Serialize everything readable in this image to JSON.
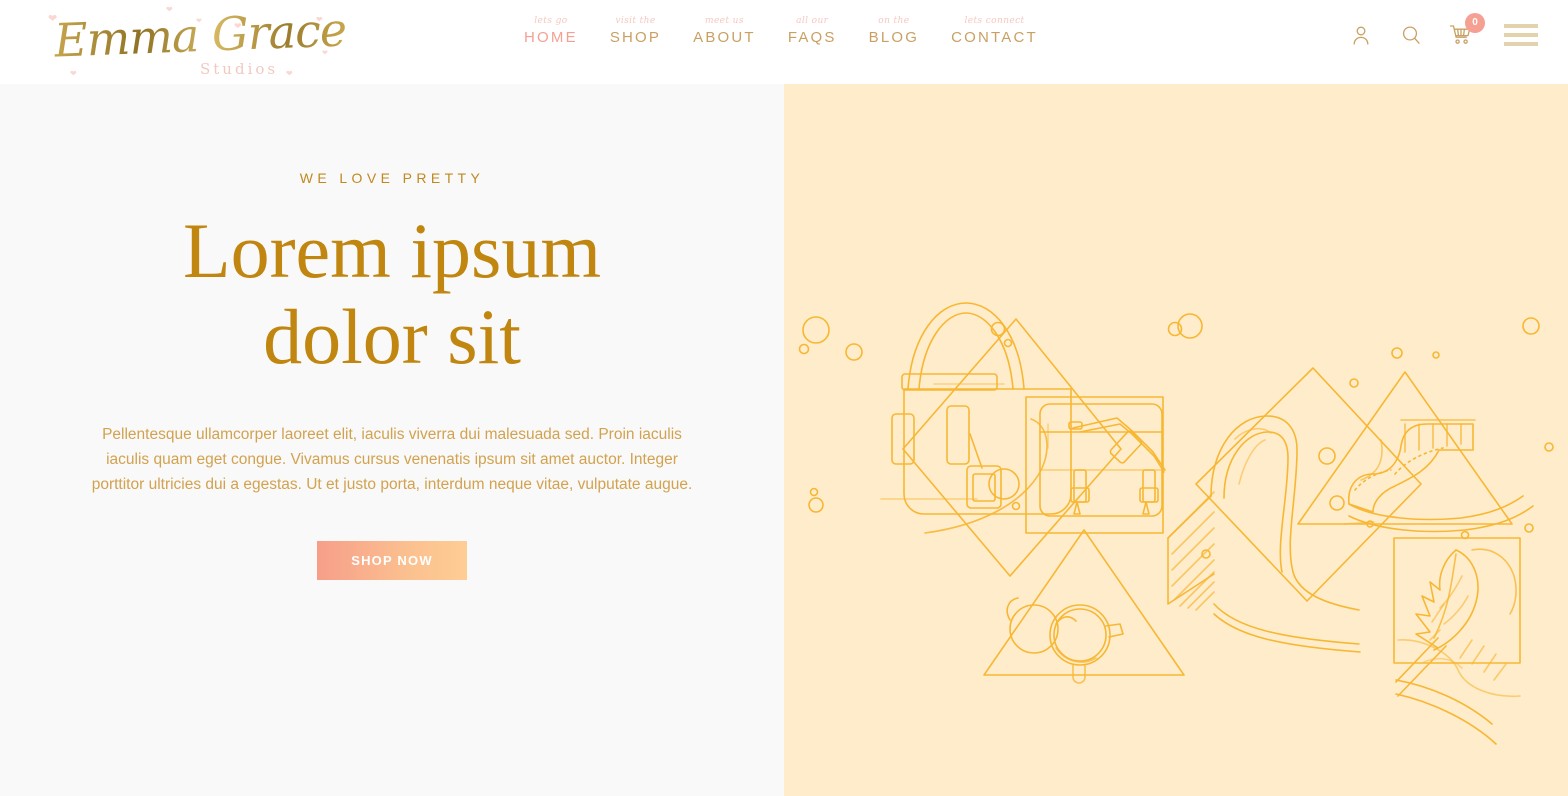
{
  "brand": {
    "name_script": "Emma Grace",
    "name_sub": "Studios",
    "gold": "#b59243",
    "pink": "#f1c9c1"
  },
  "nav": {
    "items": [
      {
        "pre": "lets go",
        "label": "HOME",
        "active": true
      },
      {
        "pre": "visit the",
        "label": "SHOP",
        "active": false
      },
      {
        "pre": "meet us",
        "label": "ABOUT",
        "active": false
      },
      {
        "pre": "all our",
        "label": "FAQS",
        "active": false
      },
      {
        "pre": "on the",
        "label": "BLOG",
        "active": false
      },
      {
        "pre": "lets connect",
        "label": "CONTACT",
        "active": false
      }
    ],
    "active_color": "#f4a193",
    "idle_color": "#c9a063",
    "pre_color": "#f6c8c1"
  },
  "header_icons": {
    "account": "account-icon",
    "search": "search-icon",
    "cart": "cart-icon",
    "cart_count": "0",
    "cart_badge_color": "#f6a093",
    "menu": "hamburger-menu-icon",
    "icon_color": "#c9a063"
  },
  "hero": {
    "eyebrow": "WE LOVE PRETTY",
    "headline": "Lorem ipsum dolor sit",
    "paragraph": "Pellentesque ullamcorper laoreet elit, iaculis viverra dui malesuada sed. Proin iaculis iaculis quam eget congue. Vivamus cursus venenatis ipsum sit amet auctor. Integer porttitor ultricies dui a egestas. Ut et justo porta, interdum neque vitae, vulputate augue.",
    "cta_label": "SHOP NOW",
    "left_bg": "#f9f9fa",
    "right_bg": "#ffeccb",
    "headline_color": "#c0860f",
    "eyebrow_color": "#c0891f",
    "paragraph_color": "#d2a24e",
    "cta_gradient_from": "#f79e8a",
    "cta_gradient_to": "#fecd94"
  },
  "illustration": {
    "line_color": "#f7b733",
    "items": [
      "handbag-in-diamond",
      "satchel-in-square",
      "sunglasses-in-triangle",
      "high-heel-in-diamond",
      "sneaker-in-triangle",
      "feather-quill-in-square"
    ]
  }
}
